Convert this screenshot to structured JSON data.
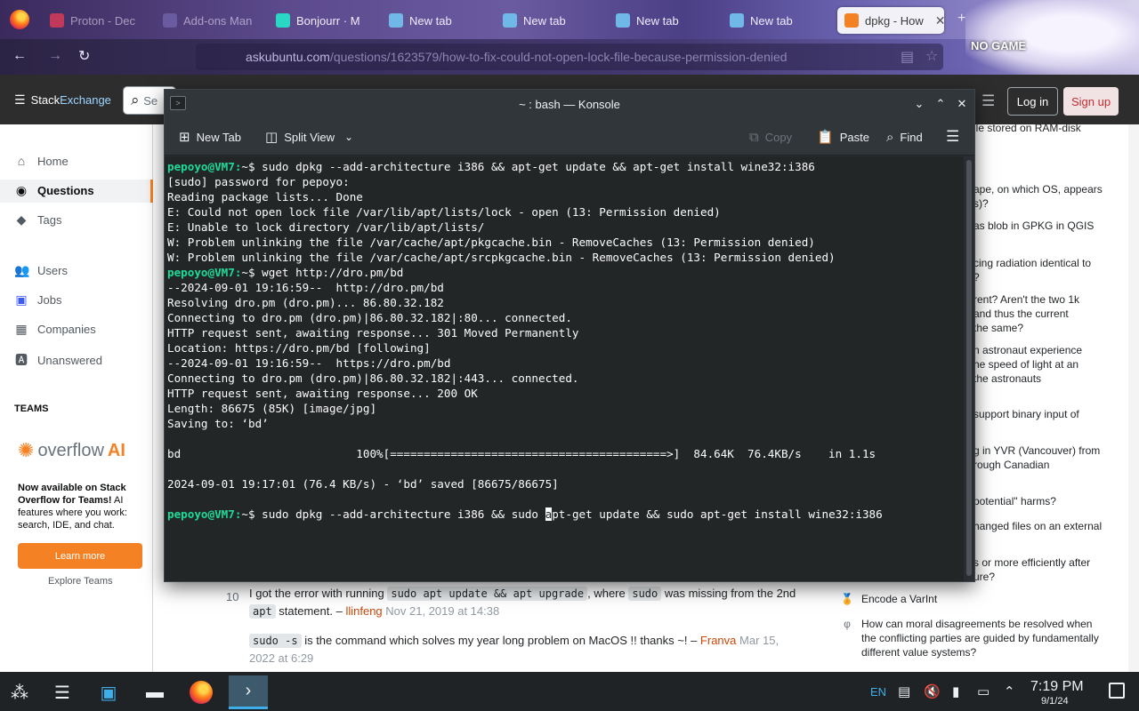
{
  "browser": {
    "tabs": [
      {
        "label": "Bonjourr · M",
        "color": "#2ad6c4"
      },
      {
        "label": "New tab",
        "color": "#6fb8e8"
      },
      {
        "label": "New tab",
        "color": "#6fb8e8"
      },
      {
        "label": "New tab",
        "color": "#6fb8e8"
      },
      {
        "label": "New tab",
        "color": "#6fb8e8"
      },
      {
        "label": "dpkg - How",
        "color": "#f48225"
      }
    ],
    "dim_tabs": [
      "Proton - Dec",
      "Add-ons Man"
    ],
    "url_host": "askubuntu.com",
    "url_path": "/questions/1623579/how-to-fix-could-not-open-lock-file-because-permission-denied",
    "banner_text": "NO GAME"
  },
  "se": {
    "logo_prefix": "Stack",
    "logo_suffix": "Exchange",
    "search_icon": "search-icon",
    "search_placeholder": "Se",
    "login": "Log in",
    "signup": "Sign up",
    "nav": {
      "home": "Home",
      "questions": "Questions",
      "tags": "Tags",
      "users": "Users",
      "jobs": "Jobs",
      "companies": "Companies",
      "unanswered": "Unanswered"
    },
    "teams_label": "TEAMS",
    "overflow_word": "overflow",
    "overflow_ai": "AI",
    "teams_promo_bold": "Now available on Stack Overflow for Teams!",
    "teams_promo_text": " AI features where you work: search, IDE, and chat.",
    "learn_more": "Learn more",
    "explore_teams": "Explore Teams"
  },
  "comments": [
    {
      "score": "10",
      "parts": [
        "I got the error with running ",
        "sudo apt update && apt upgrade",
        ", where ",
        "sudo",
        " was missing from the 2nd ",
        "apt",
        " statement. – "
      ],
      "user": "llinfeng",
      "date": "Nov 21, 2019 at 14:38"
    },
    {
      "score": "",
      "parts": [
        "sudo -s",
        " is the command which solves my year long problem on MacOS !! thanks ~! – "
      ],
      "user": "Franva",
      "date": "Mar 15, 2022 at 6:29"
    }
  ],
  "hot_network": [
    "ile stored on RAM-disk",
    "ape, on which OS, appears",
    "s)?",
    "as blob in GPKG in QGIS",
    "cing radiation identical to",
    "?",
    "rent? Aren't the two 1k",
    "and thus the current",
    " the same?",
    "n astronaut experience",
    "he speed of light at an",
    " the astronauts",
    "support binary input of",
    "g in YVR (Vancouver) from",
    "rough Canadian",
    "potential\" harms?",
    "hanged files on an external",
    "s or more efficiently after",
    "ure?"
  ],
  "hot_bottom": [
    {
      "icon": "award-icon",
      "text": "Encode a VarInt"
    },
    {
      "icon": "philosophy-icon",
      "text": "How can moral disagreements be resolved when the conflicting parties are guided by fundamentally different value systems?"
    }
  ],
  "konsole": {
    "title": "~ : bash — Konsole",
    "new_tab": "New Tab",
    "split_view": "Split View",
    "copy": "Copy",
    "paste": "Paste",
    "find": "Find",
    "prompt": "pepoyo@VM7:",
    "lines": [
      {
        "p": true,
        "t": "~$ sudo dpkg --add-architecture i386 && apt-get update && apt-get install wine32:i386"
      },
      {
        "p": false,
        "t": "[sudo] password for pepoyo:"
      },
      {
        "p": false,
        "t": "Reading package lists... Done"
      },
      {
        "p": false,
        "t": "E: Could not open lock file /var/lib/apt/lists/lock - open (13: Permission denied)"
      },
      {
        "p": false,
        "t": "E: Unable to lock directory /var/lib/apt/lists/"
      },
      {
        "p": false,
        "t": "W: Problem unlinking the file /var/cache/apt/pkgcache.bin - RemoveCaches (13: Permission denied)"
      },
      {
        "p": false,
        "t": "W: Problem unlinking the file /var/cache/apt/srcpkgcache.bin - RemoveCaches (13: Permission denied)"
      },
      {
        "p": true,
        "t": "~$ wget http://dro.pm/bd"
      },
      {
        "p": false,
        "t": "--2024-09-01 19:16:59--  http://dro.pm/bd"
      },
      {
        "p": false,
        "t": "Resolving dro.pm (dro.pm)... 86.80.32.182"
      },
      {
        "p": false,
        "t": "Connecting to dro.pm (dro.pm)|86.80.32.182|:80... connected."
      },
      {
        "p": false,
        "t": "HTTP request sent, awaiting response... 301 Moved Permanently"
      },
      {
        "p": false,
        "t": "Location: https://dro.pm/bd [following]"
      },
      {
        "p": false,
        "t": "--2024-09-01 19:16:59--  https://dro.pm/bd"
      },
      {
        "p": false,
        "t": "Connecting to dro.pm (dro.pm)|86.80.32.182|:443... connected."
      },
      {
        "p": false,
        "t": "HTTP request sent, awaiting response... 200 OK"
      },
      {
        "p": false,
        "t": "Length: 86675 (85K) [image/jpg]"
      },
      {
        "p": false,
        "t": "Saving to: ‘bd’"
      },
      {
        "p": false,
        "t": ""
      },
      {
        "p": false,
        "t": "bd                          100%[=========================================>]  84.64K  76.4KB/s    in 1.1s"
      },
      {
        "p": false,
        "t": ""
      },
      {
        "p": false,
        "t": "2024-09-01 19:17:01 (76.4 KB/s) - ‘bd’ saved [86675/86675]"
      },
      {
        "p": false,
        "t": ""
      }
    ],
    "last_prompt_before": "~$ sudo dpkg --add-architecture i386 && sudo ",
    "last_prompt_cursor": "a",
    "last_prompt_after": "pt-get update && sudo apt-get install wine32:i386"
  },
  "taskbar": {
    "lang": "EN",
    "time": "7:19 PM",
    "date": "9/1/24"
  }
}
